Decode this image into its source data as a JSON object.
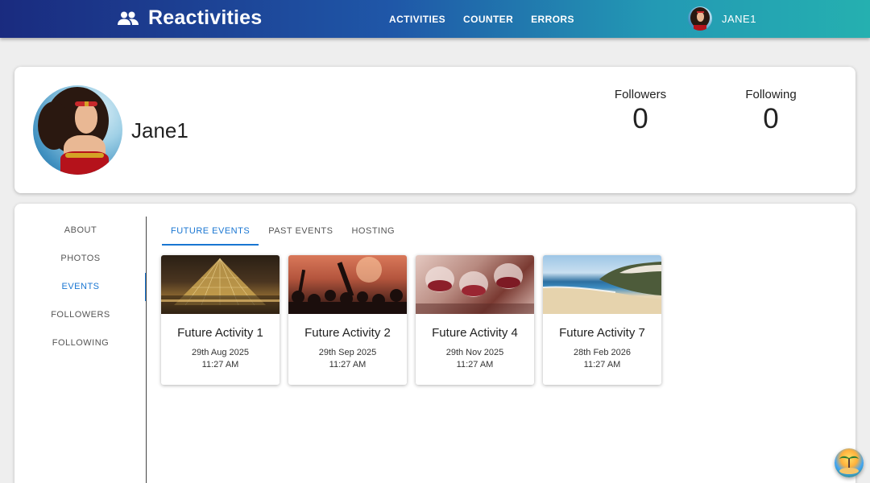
{
  "header": {
    "brand": "Reactivities",
    "nav": [
      "ACTIVITIES",
      "COUNTER",
      "ERRORS"
    ],
    "user_name": "JANE1"
  },
  "profile": {
    "display_name": "Jane1",
    "stats": [
      {
        "label": "Followers",
        "value": "0"
      },
      {
        "label": "Following",
        "value": "0"
      }
    ]
  },
  "side_nav": {
    "items": [
      "ABOUT",
      "PHOTOS",
      "EVENTS",
      "FOLLOWERS",
      "FOLLOWING"
    ],
    "active": "EVENTS"
  },
  "events": {
    "tabs": [
      "FUTURE EVENTS",
      "PAST EVENTS",
      "HOSTING"
    ],
    "active_tab": "FUTURE EVENTS",
    "cards": [
      {
        "title": "Future Activity 1",
        "date": "29th Aug 2025",
        "time": "11:27 AM",
        "image": "louvre-pyramid-night"
      },
      {
        "title": "Future Activity 2",
        "date": "29th Sep 2025",
        "time": "11:27 AM",
        "image": "concert-crowd"
      },
      {
        "title": "Future Activity 4",
        "date": "29th Nov 2025",
        "time": "11:27 AM",
        "image": "wine-glasses-toast"
      },
      {
        "title": "Future Activity 7",
        "date": "28th Feb 2026",
        "time": "11:27 AM",
        "image": "beach-coast"
      }
    ]
  },
  "colors": {
    "accent": "#1976d2",
    "header_start": "#1a2b7f",
    "header_end": "#25b0b0"
  }
}
